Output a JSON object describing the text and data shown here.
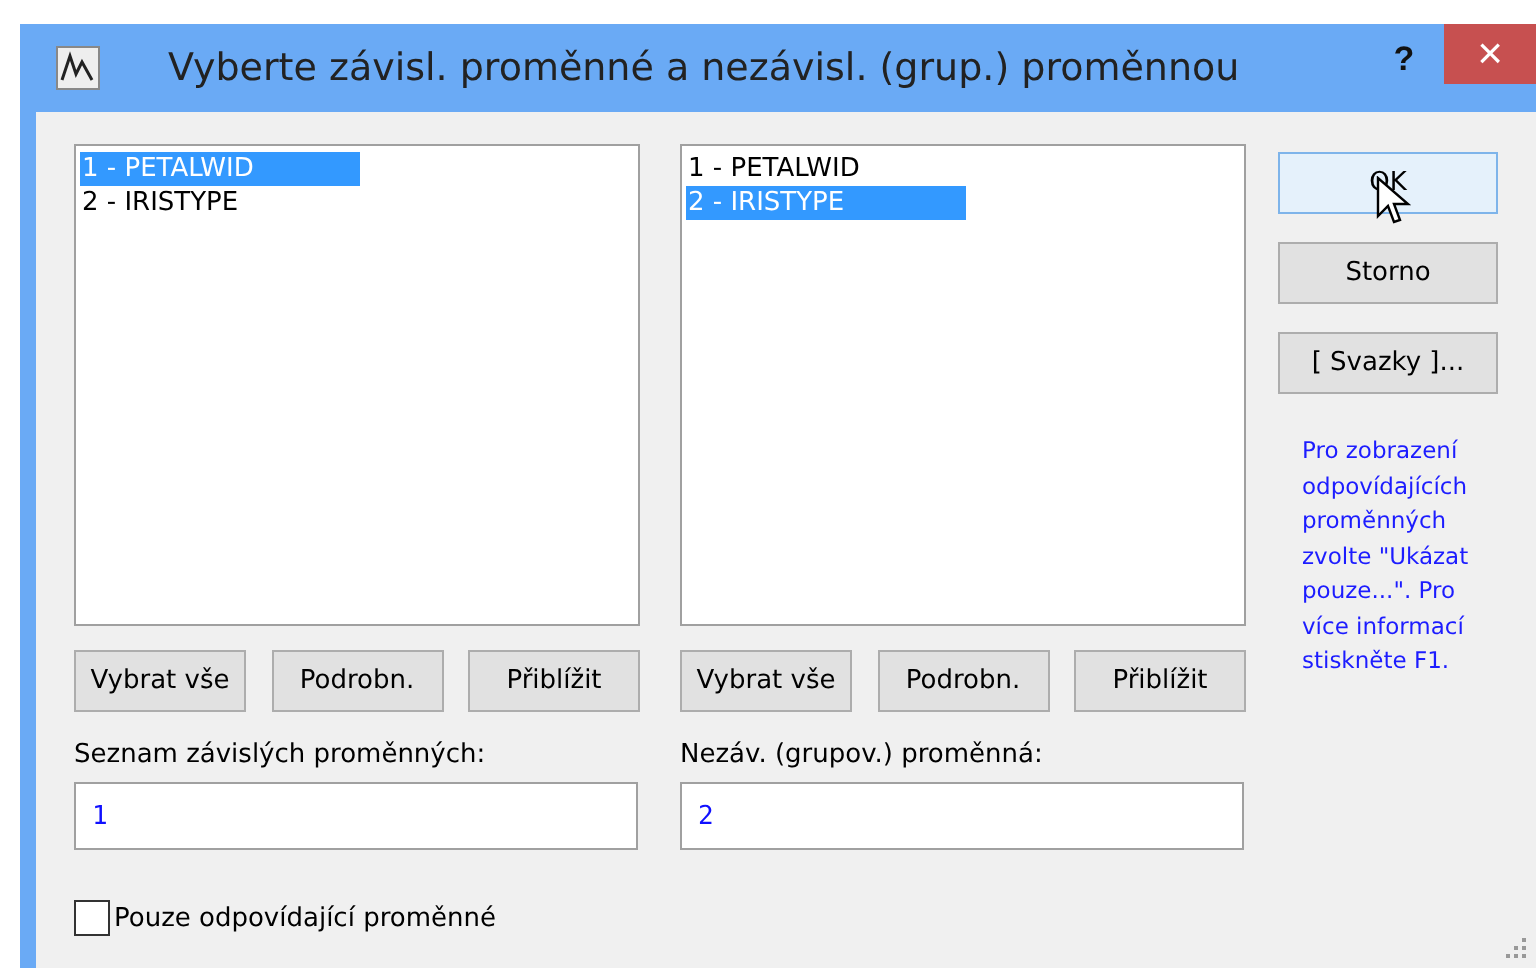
{
  "window": {
    "title": "Vyberte závisl. proměnné a nezávisl. (grup.) proměnnou",
    "help": "?",
    "close": "×"
  },
  "lists": [
    {
      "items": [
        {
          "label": "1 - PETALWID",
          "selected": true
        },
        {
          "label": "2 - IRISTYPE",
          "selected": false
        }
      ],
      "buttons": [
        "Vybrat vše",
        "Podrobn.",
        "Přiblížit"
      ],
      "field_label": "Seznam závislých proměnných:",
      "field_value": "1"
    },
    {
      "items": [
        {
          "label": "1 - PETALWID",
          "selected": false
        },
        {
          "label": "2 - IRISTYPE",
          "selected": true
        }
      ],
      "buttons": [
        "Vybrat vše",
        "Podrobn.",
        "Přiblížit"
      ],
      "field_label": "Nezáv. (grupov.) proměnná:",
      "field_value": "2"
    }
  ],
  "side_buttons": [
    {
      "label": "OK",
      "default": true
    },
    {
      "label": "Storno",
      "default": false
    },
    {
      "label": "[ Svazky ]...",
      "default": false
    }
  ],
  "help_text": "Pro zobrazení odpovídajících proměnných zvolte \"Ukázat pouze...\". Pro více informací stiskněte F1.",
  "checkbox": {
    "label": "Pouze odpovídající proměnné",
    "checked": false
  }
}
